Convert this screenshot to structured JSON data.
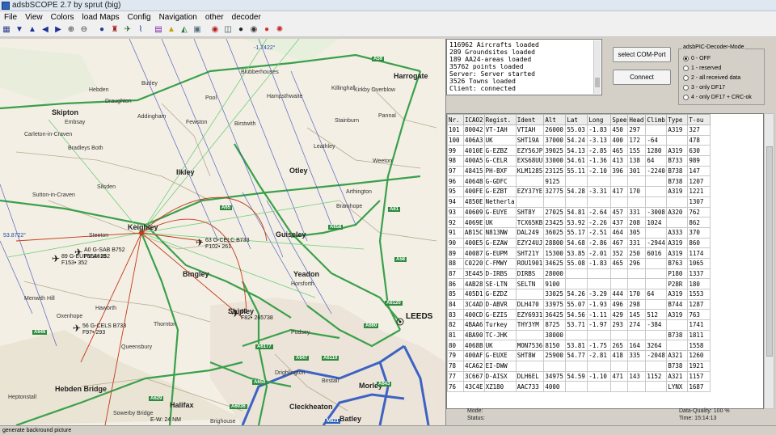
{
  "window": {
    "title": "adsbSCOPE 2.7 by sprut  (big)"
  },
  "menu": [
    "File",
    "View",
    "Colors",
    "load Maps",
    "Config",
    "Navigation",
    "other",
    "decoder"
  ],
  "toolbar": [
    {
      "icon": "grid-icon",
      "glyph": "▦",
      "color": "#2b3b8c"
    },
    {
      "icon": "arrow-down-icon",
      "glyph": "▼",
      "color": "#1b2f9a"
    },
    {
      "icon": "arrow-up-icon",
      "glyph": "▲",
      "color": "#1b2f9a"
    },
    {
      "icon": "arrow-left-icon",
      "glyph": "◀",
      "color": "#1b2f9a"
    },
    {
      "icon": "arrow-right-icon",
      "glyph": "▶",
      "color": "#1b2f9a"
    },
    {
      "icon": "zoom-in-icon",
      "glyph": "⊕",
      "color": "#333333"
    },
    {
      "icon": "zoom-out-icon",
      "glyph": "⊖",
      "color": "#333333"
    },
    {
      "icon": "globe-icon",
      "glyph": "●",
      "color": "#1e3a8a"
    },
    {
      "icon": "antenna-icon",
      "glyph": "♜",
      "color": "#a01a1a"
    },
    {
      "icon": "airport-icon",
      "glyph": "✈",
      "color": "#1b5e20"
    },
    {
      "icon": "path-icon",
      "glyph": "⌇",
      "color": "#1b2f9a"
    },
    {
      "icon": "filter-icon",
      "glyph": "▤",
      "color": "#7a1fa2"
    },
    {
      "icon": "warning-icon",
      "glyph": "▲",
      "color": "#c8a000"
    },
    {
      "icon": "terrain-icon",
      "glyph": "◭",
      "color": "#2e7d32"
    },
    {
      "icon": "map-layer-icon",
      "glyph": "▣",
      "color": "#546e7a"
    },
    {
      "icon": "record-icon",
      "glyph": "◉",
      "color": "#b71c1c"
    },
    {
      "icon": "display-icon",
      "glyph": "◫",
      "color": "#37474f"
    },
    {
      "icon": "dot-black-icon",
      "glyph": "●",
      "color": "#222222"
    },
    {
      "icon": "dot-dark-icon",
      "glyph": "◉",
      "color": "#333333"
    },
    {
      "icon": "stop-icon",
      "glyph": "●",
      "color": "#d32f2f"
    },
    {
      "icon": "settings-icon",
      "glyph": "✺",
      "color": "#c62828"
    }
  ],
  "log": [
    "116962 Aircrafts loaded",
    "289 Groundsites loaded",
    "189 AA24-areas loaded",
    "35762 points loaded",
    "Server: Server started",
    "3526 Towns loaded",
    "Client: connected"
  ],
  "buttons": {
    "com_port": "select COM-Port",
    "connect": "Connect"
  },
  "decoder": {
    "title": "adsbPIC-Decoder-Mode",
    "options": [
      "0 - OFF",
      "1 - reserved",
      "2 - all received data",
      "3 - only DF17",
      "4 - only DF17 + CRC-ok"
    ],
    "selected": 0
  },
  "table": {
    "columns": [
      "Nr.",
      "ICAO2",
      "Regist.",
      "Ident",
      "Alt",
      "Lat",
      "Long",
      "Spee",
      "Head",
      "Climb",
      "Type",
      "T-ou"
    ],
    "rows": [
      [
        "101",
        "80042",
        "VT-IAH",
        "VTIAH",
        "26000",
        "55.03",
        "-1.83",
        "450",
        "297",
        "",
        "A319",
        "327"
      ],
      [
        "100",
        "406A3",
        "UK",
        "SHT19A",
        "37000",
        "54.24",
        "-3.13",
        "400",
        "172",
        "-64",
        "",
        "478"
      ],
      [
        "99",
        "4010E",
        "G-EZBZ",
        "EZY56JP",
        "39025",
        "54.13",
        "-2.85",
        "465",
        "155",
        "1280",
        "A319",
        "630"
      ],
      [
        "98",
        "400A5",
        "G-CELR",
        "EXS68UU",
        "33000",
        "54.61",
        "-1.36",
        "413",
        "138",
        "64",
        "B733",
        "989"
      ],
      [
        "97",
        "48415",
        "PH-BXF",
        "KLM1285",
        "23125",
        "55.11",
        "-2.10",
        "396",
        "301",
        "-2240",
        "B738",
        "147"
      ],
      [
        "96",
        "4064B",
        "G-GDFC",
        "",
        "9125",
        "",
        "",
        "",
        "",
        "",
        "B738",
        "1207"
      ],
      [
        "95",
        "400FE",
        "G-EZBT",
        "EZY37YE",
        "32775",
        "54.28",
        "-3.31",
        "417",
        "170",
        "",
        "A319",
        "1221"
      ],
      [
        "94",
        "4850E",
        "Netherla",
        "",
        "",
        "",
        "",
        "",
        "",
        "",
        "",
        "1307"
      ],
      [
        "93",
        "40609",
        "G-EUYE",
        "SHT8Y",
        "27025",
        "54.81",
        "-2.64",
        "457",
        "331",
        "-3008",
        "A320",
        "762"
      ],
      [
        "92",
        "4069E",
        "UK",
        "TCX65KB",
        "23425",
        "53.92",
        "-2.26",
        "437",
        "208",
        "1024",
        "",
        "862"
      ],
      [
        "91",
        "AB15C",
        "N813NW",
        "DAL249",
        "36025",
        "55.17",
        "-2.51",
        "464",
        "305",
        "",
        "A333",
        "370"
      ],
      [
        "90",
        "400E5",
        "G-EZAW",
        "EZY24UJ",
        "28800",
        "54.68",
        "-2.86",
        "467",
        "331",
        "-2944",
        "A319",
        "860"
      ],
      [
        "89",
        "40087",
        "G-EUPM",
        "SHT21Y",
        "15300",
        "53.85",
        "-2.01",
        "352",
        "250",
        "6016",
        "A319",
        "1174"
      ],
      [
        "88",
        "C0220",
        "C-FMWY",
        "ROU1901",
        "34625",
        "55.08",
        "-1.83",
        "465",
        "296",
        "",
        "B763",
        "1065"
      ],
      [
        "87",
        "3E445",
        "D-IRBS",
        "DIRBS",
        "28000",
        "",
        "",
        "",
        "",
        "",
        "P180",
        "1337"
      ],
      [
        "86",
        "4AB28",
        "SE-LTN",
        "SELTN",
        "9100",
        "",
        "",
        "",
        "",
        "",
        "P28R",
        "180"
      ],
      [
        "85",
        "405D1",
        "G-EZDZ",
        "",
        "33025",
        "54.26",
        "-3.29",
        "444",
        "170",
        "64",
        "A319",
        "1553"
      ],
      [
        "84",
        "3C4AD",
        "D-ABVR",
        "DLH470",
        "33975",
        "55.07",
        "-1.93",
        "496",
        "298",
        "",
        "B744",
        "1287"
      ],
      [
        "83",
        "400CD",
        "G-EZIS",
        "EZY6931",
        "36425",
        "54.56",
        "-1.11",
        "429",
        "145",
        "512",
        "A319",
        "763"
      ],
      [
        "82",
        "4BAA6",
        "Turkey",
        "THY3YM",
        "8725",
        "53.71",
        "-1.97",
        "293",
        "274",
        "-384",
        "",
        "1741"
      ],
      [
        "81",
        "4BA90",
        "TC-JHK",
        "",
        "38000",
        "",
        "",
        "",
        "",
        "",
        "B738",
        "1811"
      ],
      [
        "80",
        "4068B",
        "UK",
        "MON7536",
        "8150",
        "53.81",
        "-1.75",
        "265",
        "164",
        "3264",
        "",
        "1558"
      ],
      [
        "79",
        "400AF",
        "G-EUXE",
        "SHT8W",
        "25900",
        "54.77",
        "-2.81",
        "418",
        "335",
        "-2048",
        "A321",
        "1260"
      ],
      [
        "78",
        "4CA62",
        "EI-DWW",
        "",
        "",
        "",
        "",
        "",
        "",
        "",
        "B738",
        "1921"
      ],
      [
        "77",
        "3C667",
        "D-AISX",
        "DLH6EL",
        "34975",
        "54.59",
        "-1.10",
        "471",
        "143",
        "1152",
        "A321",
        "1157"
      ],
      [
        "76",
        "43C4E",
        "XZ180",
        "AAC733",
        "4000",
        "",
        "",
        "",
        "",
        "",
        "LYNX",
        "1687"
      ]
    ]
  },
  "status": {
    "mode_label": "Mode:",
    "status_label": "Status:",
    "data_quality": "Data-Quality: 100 %",
    "time": "Time: 15:14:13",
    "bottom": "generate backround picture",
    "scale": "E-W: 24 NM"
  },
  "map": {
    "coord_top": "-1.7422°",
    "coord_left": "53.8722°",
    "towns": [
      {
        "name": "Harrogate",
        "cls": "town"
      },
      {
        "name": "Skipton",
        "cls": "town"
      },
      {
        "name": "Ilkley",
        "cls": "town"
      },
      {
        "name": "Otley",
        "cls": "town"
      },
      {
        "name": "Keighley",
        "cls": "town"
      },
      {
        "name": "Guiseley",
        "cls": "town"
      },
      {
        "name": "Yeadon",
        "cls": "town"
      },
      {
        "name": "Bingley",
        "cls": "town"
      },
      {
        "name": "Shipley",
        "cls": "town"
      },
      {
        "name": "LEEDS",
        "cls": "city"
      },
      {
        "name": "Halifax",
        "cls": "town"
      },
      {
        "name": "Hebden Bridge",
        "cls": "town"
      },
      {
        "name": "Cleckheaton",
        "cls": "town"
      },
      {
        "name": "Morley",
        "cls": "town"
      },
      {
        "name": "Batley",
        "cls": "town"
      },
      {
        "name": "Bradleys Both",
        "cls": ""
      },
      {
        "name": "Addingham",
        "cls": ""
      },
      {
        "name": "Draughton",
        "cls": ""
      },
      {
        "name": "Blubberhouses",
        "cls": ""
      },
      {
        "name": "Burley",
        "cls": ""
      },
      {
        "name": "Pool",
        "cls": ""
      },
      {
        "name": "Leathley",
        "cls": ""
      },
      {
        "name": "Stainburn",
        "cls": ""
      },
      {
        "name": "Weeton",
        "cls": ""
      },
      {
        "name": "Arthington",
        "cls": ""
      },
      {
        "name": "Bramhope",
        "cls": ""
      },
      {
        "name": "Haworth",
        "cls": ""
      },
      {
        "name": "Queensbury",
        "cls": ""
      },
      {
        "name": "Thornton",
        "cls": ""
      },
      {
        "name": "Pudsey",
        "cls": ""
      },
      {
        "name": "Horsforth",
        "cls": ""
      },
      {
        "name": "Oxenhope",
        "cls": ""
      },
      {
        "name": "Heptonstall",
        "cls": ""
      },
      {
        "name": "Sowerby Bridge",
        "cls": ""
      },
      {
        "name": "Brighouse",
        "cls": ""
      },
      {
        "name": "Drighlington",
        "cls": ""
      },
      {
        "name": "Birstall",
        "cls": ""
      },
      {
        "name": "Embsay",
        "cls": ""
      },
      {
        "name": "Carleton-in-Craven",
        "cls": ""
      },
      {
        "name": "Steeton",
        "cls": ""
      },
      {
        "name": "Silsden",
        "cls": ""
      },
      {
        "name": "Sutton-in-Craven",
        "cls": ""
      },
      {
        "name": "Hampsthwaite",
        "cls": ""
      },
      {
        "name": "Birstwith",
        "cls": ""
      },
      {
        "name": "Pannal",
        "cls": ""
      },
      {
        "name": "Killinghall",
        "cls": ""
      },
      {
        "name": "Fewston",
        "cls": ""
      },
      {
        "name": "Menwith Hill",
        "cls": ""
      },
      {
        "name": "Kirkby Overblow",
        "cls": ""
      },
      {
        "name": "Hebden",
        "cls": ""
      }
    ],
    "roads": [
      {
        "name": "A59",
        "cls": "road"
      },
      {
        "name": "A61",
        "cls": "road"
      },
      {
        "name": "A65",
        "cls": "road"
      },
      {
        "name": "A658",
        "cls": "road"
      },
      {
        "name": "A629",
        "cls": "road"
      },
      {
        "name": "A6120",
        "cls": "road"
      },
      {
        "name": "A660",
        "cls": "road"
      },
      {
        "name": "A6177",
        "cls": "road"
      },
      {
        "name": "A647",
        "cls": "road"
      },
      {
        "name": "A6110",
        "cls": "road"
      },
      {
        "name": "A650",
        "cls": "road"
      },
      {
        "name": "A6036",
        "cls": "road"
      },
      {
        "name": "A643",
        "cls": "road"
      },
      {
        "name": "A58",
        "cls": "road"
      },
      {
        "name": "A646",
        "cls": "road"
      },
      {
        "name": "M621",
        "cls": "mway"
      }
    ],
    "aircraft": [
      {
        "text": "A0 G-SAB B752\nF153• 352",
        "heading": "✈"
      },
      {
        "text": "89 G-EUPM A319\nF153• 352",
        "heading": "✈"
      },
      {
        "text": "63 G-CELC B733\nF102• 261",
        "heading": "✈"
      },
      {
        "text": "80\nF82• 265738",
        "heading": "✈"
      },
      {
        "text": "56 G-CELS B733\nF97• 293",
        "heading": "✈"
      }
    ]
  }
}
